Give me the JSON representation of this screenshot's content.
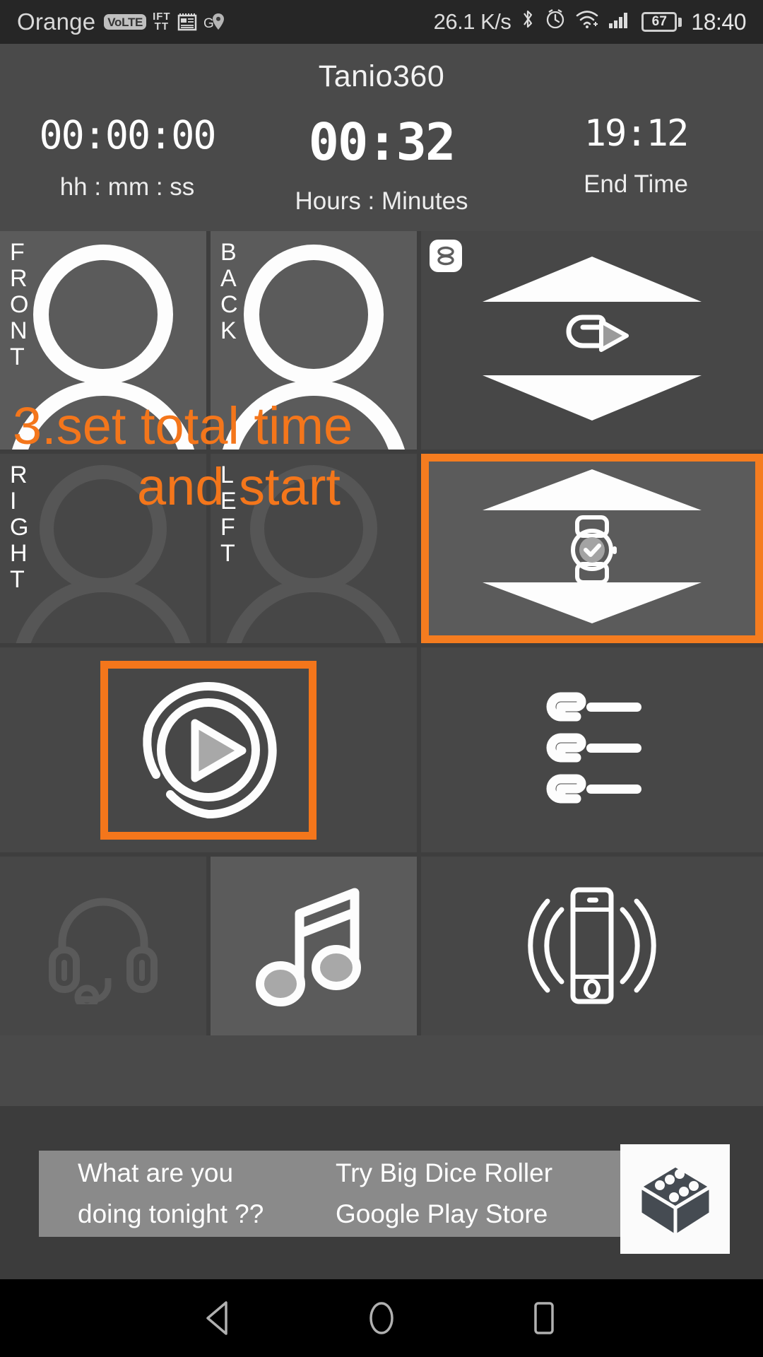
{
  "status_bar": {
    "carrier": "Orange",
    "volte_badge": "VoLTE",
    "ifttt_badge": "IFT TT",
    "icons": [
      "volte-icon",
      "ifttt-icon",
      "news-icon",
      "google-maps-icon",
      "bluetooth-icon",
      "alarm-icon",
      "wifi-icon",
      "signal-icon",
      "battery-icon"
    ],
    "network_speed": "26.1 K/s",
    "battery_level": "67",
    "clock": "18:40"
  },
  "header": {
    "app_title": "Tanio360",
    "timers": [
      {
        "value": "00:00:00",
        "label": "hh : mm : ss",
        "name": "elapsed-time"
      },
      {
        "value": "00:32",
        "label": "Hours : Minutes",
        "name": "total-time"
      },
      {
        "value": "19:12",
        "label": "End Time",
        "name": "end-time"
      }
    ]
  },
  "grid": {
    "row1": [
      {
        "name": "tile-front",
        "label": "FRONT",
        "icon": "person-icon",
        "state": "active"
      },
      {
        "name": "tile-back",
        "label": "BACK",
        "icon": "person-icon",
        "state": "active"
      },
      {
        "name": "tile-repeat-stepper",
        "badge": "8",
        "icon": "repeat-icon",
        "state": "active",
        "selected": false
      }
    ],
    "row2": [
      {
        "name": "tile-right",
        "label": "RIGHT",
        "icon": "person-icon",
        "state": "disabled"
      },
      {
        "name": "tile-left",
        "label": "LEFT",
        "icon": "person-icon",
        "state": "disabled"
      },
      {
        "name": "tile-time-stepper",
        "icon": "watch-icon",
        "state": "active",
        "selected": true
      }
    ],
    "row3": [
      {
        "name": "tile-play",
        "icon": "play-circle-icon",
        "state": "active",
        "selected": true
      },
      {
        "name": "tile-playlist",
        "icon": "list-icon",
        "state": "active",
        "selected": false
      }
    ],
    "row4": [
      {
        "name": "tile-headset",
        "icon": "headset-icon",
        "state": "disabled"
      },
      {
        "name": "tile-music",
        "icon": "music-note-icon",
        "state": "active"
      },
      {
        "name": "tile-vibrate",
        "icon": "vibrate-phone-icon",
        "state": "active"
      }
    ]
  },
  "annotation": {
    "line1": "3.set total time",
    "line2": "and start",
    "color": "#f4761b"
  },
  "ad": {
    "left_line1": "What are you",
    "left_line2": "doing tonight ??",
    "right_line1": "Try Big Dice Roller",
    "right_line2": "Google Play Store",
    "icon": "dice-icon"
  },
  "nav_bar": {
    "back": "back-button",
    "home": "home-button",
    "recents": "recents-button"
  },
  "colors": {
    "accent": "#f4761b",
    "tile_light": "#5b5b5b",
    "tile_dark": "#474747",
    "background": "#4a4a4a",
    "status_bar": "#262626"
  }
}
